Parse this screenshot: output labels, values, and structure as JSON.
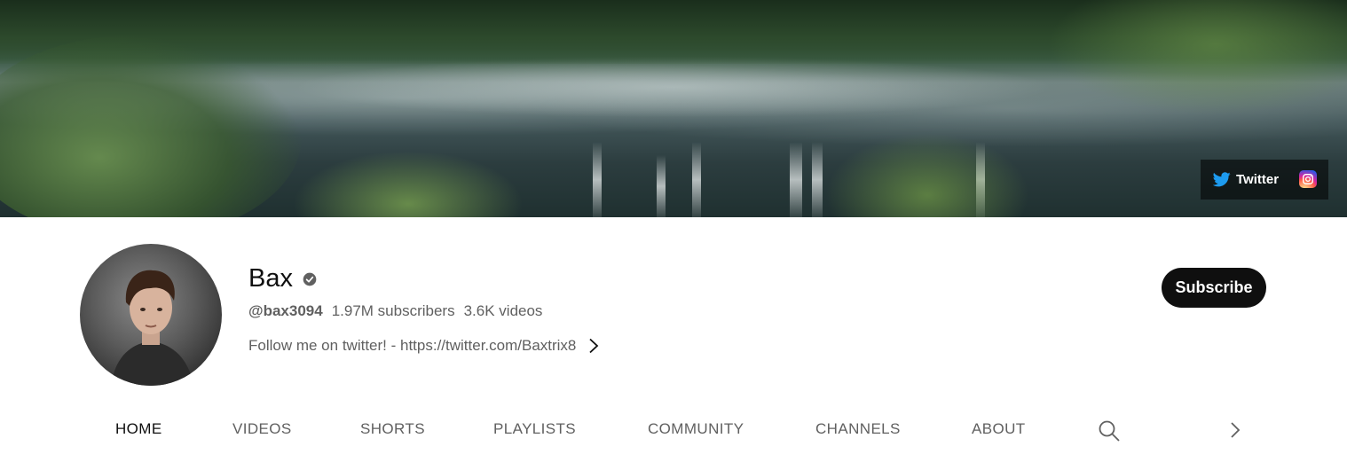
{
  "banner": {
    "links": [
      {
        "label": "Twitter",
        "icon": "twitter-icon"
      },
      {
        "label": "",
        "icon": "instagram-icon"
      }
    ]
  },
  "channel": {
    "name": "Bax",
    "verified_icon": "verified-check-icon",
    "handle": "@bax3094",
    "subscribers": "1.97M subscribers",
    "videos": "3.6K videos",
    "description": "Follow me on twitter! - https://twitter.com/Baxtrix8",
    "subscribe_label": "Subscribe"
  },
  "tabs": [
    {
      "label": "HOME",
      "active": true
    },
    {
      "label": "VIDEOS",
      "active": false
    },
    {
      "label": "SHORTS",
      "active": false
    },
    {
      "label": "PLAYLISTS",
      "active": false
    },
    {
      "label": "COMMUNITY",
      "active": false
    },
    {
      "label": "CHANNELS",
      "active": false
    },
    {
      "label": "ABOUT",
      "active": false
    }
  ],
  "colors": {
    "twitter": "#1d9bf0",
    "subscribe_bg": "#0f0f0f",
    "secondary_text": "#606060"
  }
}
